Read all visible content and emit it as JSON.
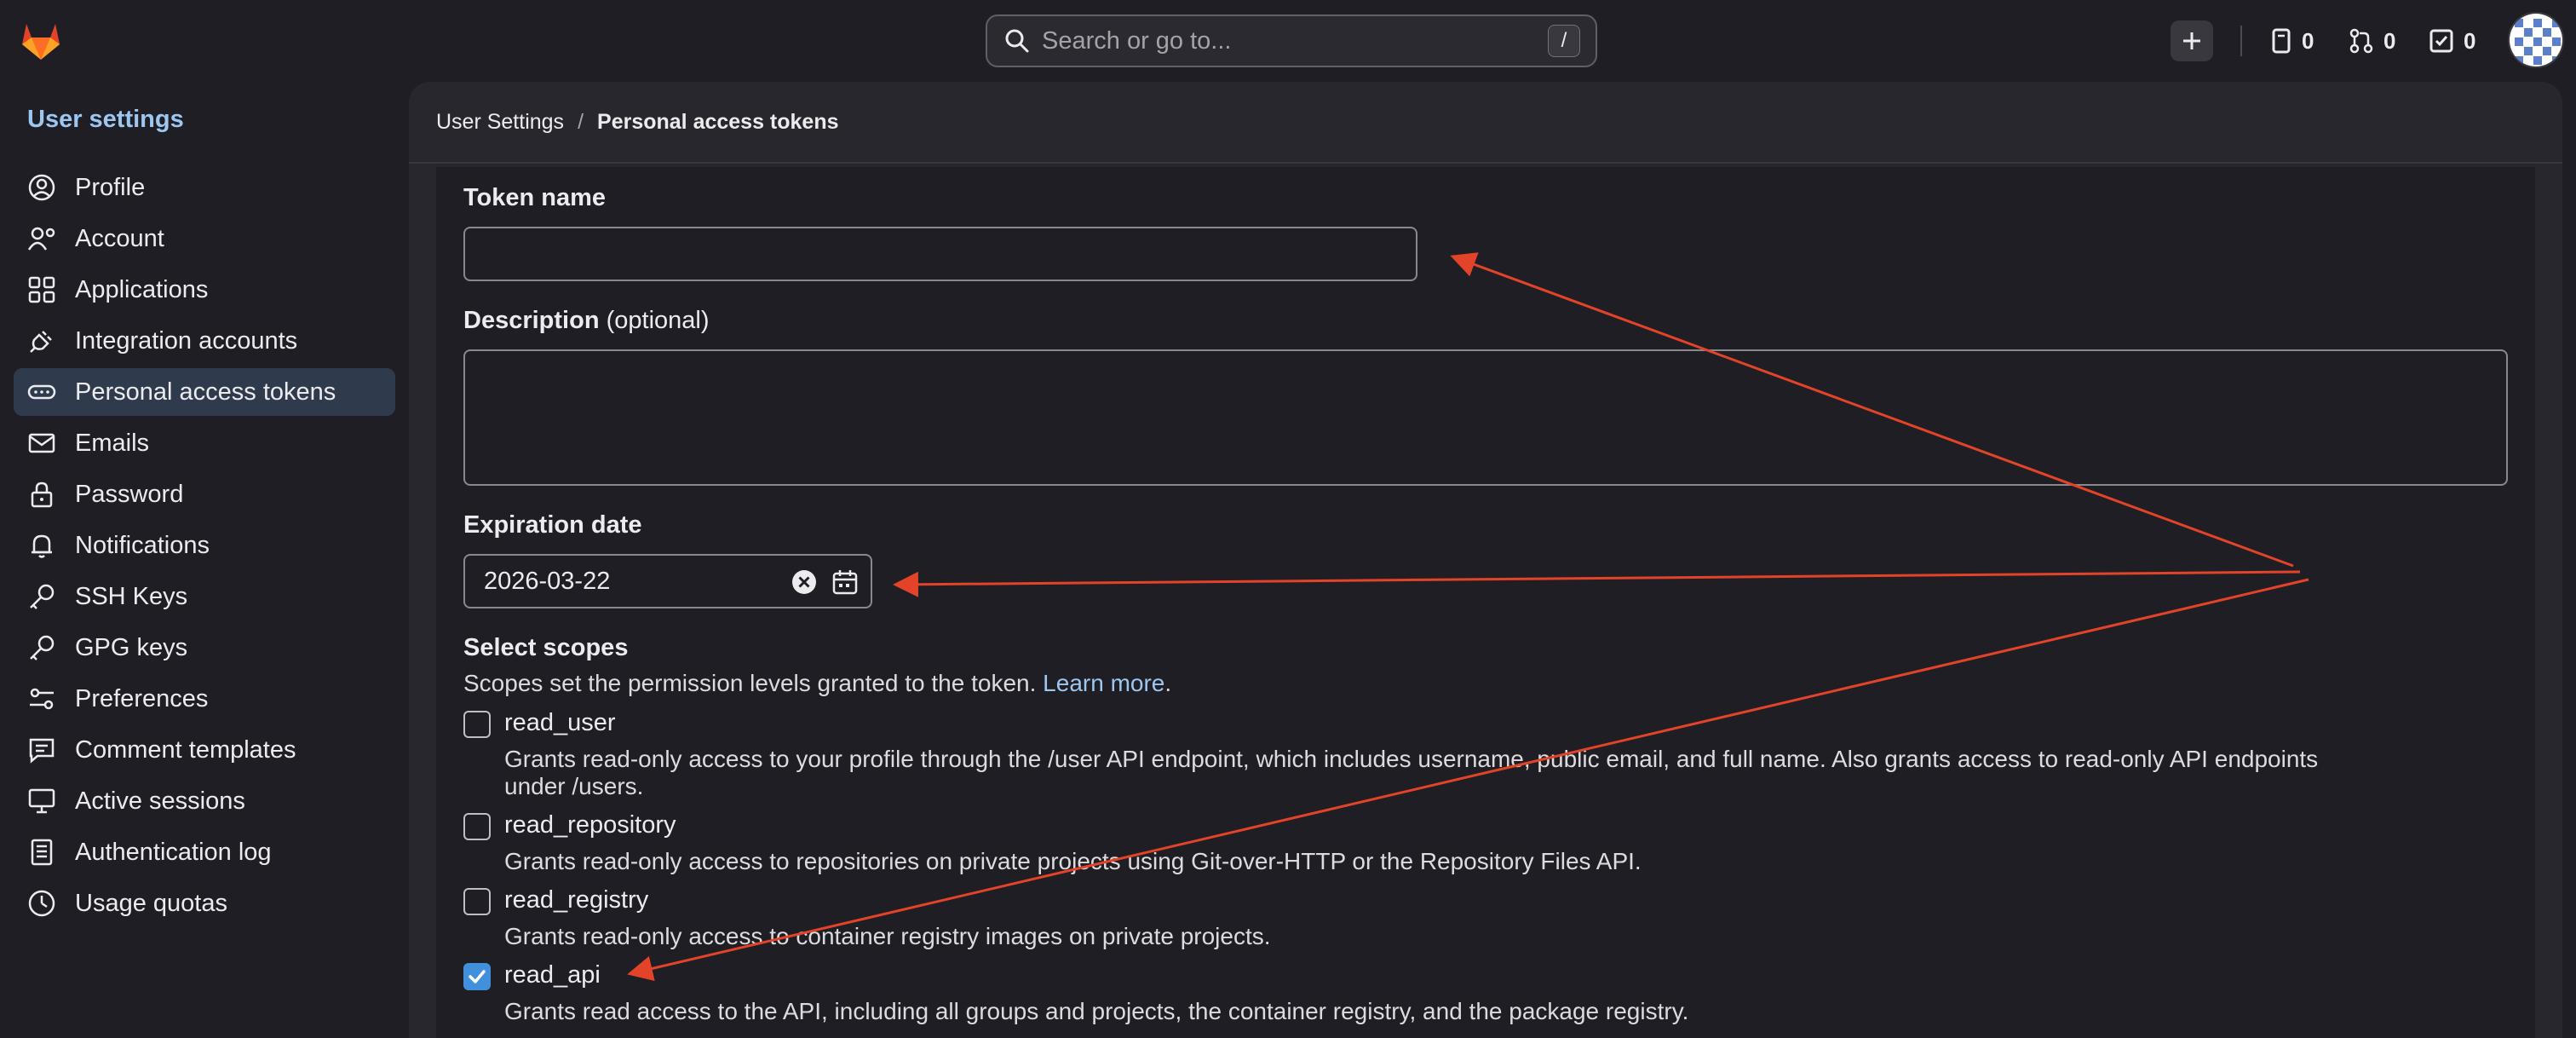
{
  "header": {
    "search_placeholder": "Search or go to...",
    "search_shortcut": "/",
    "counters": [
      {
        "icon": "issues-icon",
        "count": "0"
      },
      {
        "icon": "merge-request-icon",
        "count": "0"
      },
      {
        "icon": "todo-icon",
        "count": "0"
      }
    ]
  },
  "sidebar": {
    "title": "User settings",
    "items": [
      {
        "label": "Profile",
        "icon": "profile-icon"
      },
      {
        "label": "Account",
        "icon": "account-icon"
      },
      {
        "label": "Applications",
        "icon": "applications-icon"
      },
      {
        "label": "Integration accounts",
        "icon": "plug-icon"
      },
      {
        "label": "Personal access tokens",
        "icon": "token-icon",
        "active": true
      },
      {
        "label": "Emails",
        "icon": "mail-icon"
      },
      {
        "label": "Password",
        "icon": "lock-icon"
      },
      {
        "label": "Notifications",
        "icon": "bell-icon"
      },
      {
        "label": "SSH Keys",
        "icon": "key-icon"
      },
      {
        "label": "GPG keys",
        "icon": "key-icon"
      },
      {
        "label": "Preferences",
        "icon": "preferences-icon"
      },
      {
        "label": "Comment templates",
        "icon": "comment-icon"
      },
      {
        "label": "Active sessions",
        "icon": "monitor-icon"
      },
      {
        "label": "Authentication log",
        "icon": "log-icon"
      },
      {
        "label": "Usage quotas",
        "icon": "quota-icon"
      }
    ]
  },
  "breadcrumb": {
    "parent": "User Settings",
    "separator": "/",
    "current": "Personal access tokens"
  },
  "form": {
    "token_name_label": "Token name",
    "token_name_value": "",
    "description_label": "Description",
    "description_optional": "(optional)",
    "description_value": "",
    "expiration_label": "Expiration date",
    "expiration_value": "2026-03-22",
    "scopes_label": "Select scopes",
    "scopes_help": "Scopes set the permission levels granted to the token.",
    "scopes_help_link": "Learn more",
    "scopes_help_end": "."
  },
  "scopes": [
    {
      "name": "read_user",
      "checked": false,
      "desc_line1": "Grants read-only access to your profile through the /user API endpoint, which includes username, public email, and full name. Also grants access to read-only API endpoints",
      "desc_line2": "under /users."
    },
    {
      "name": "read_repository",
      "checked": false,
      "desc_line1": "Grants read-only access to repositories on private projects using Git-over-HTTP or the Repository Files API."
    },
    {
      "name": "read_registry",
      "checked": false,
      "desc_line1": "Grants read-only access to container registry images on private projects."
    },
    {
      "name": "read_api",
      "checked": true,
      "desc_line1": "Grants read access to the API, including all groups and projects, the container registry, and the package registry."
    }
  ],
  "colors": {
    "accent": "#428fdc",
    "annotation_arrow": "#e24329",
    "active_nav_bg": "#2f3b4d"
  }
}
